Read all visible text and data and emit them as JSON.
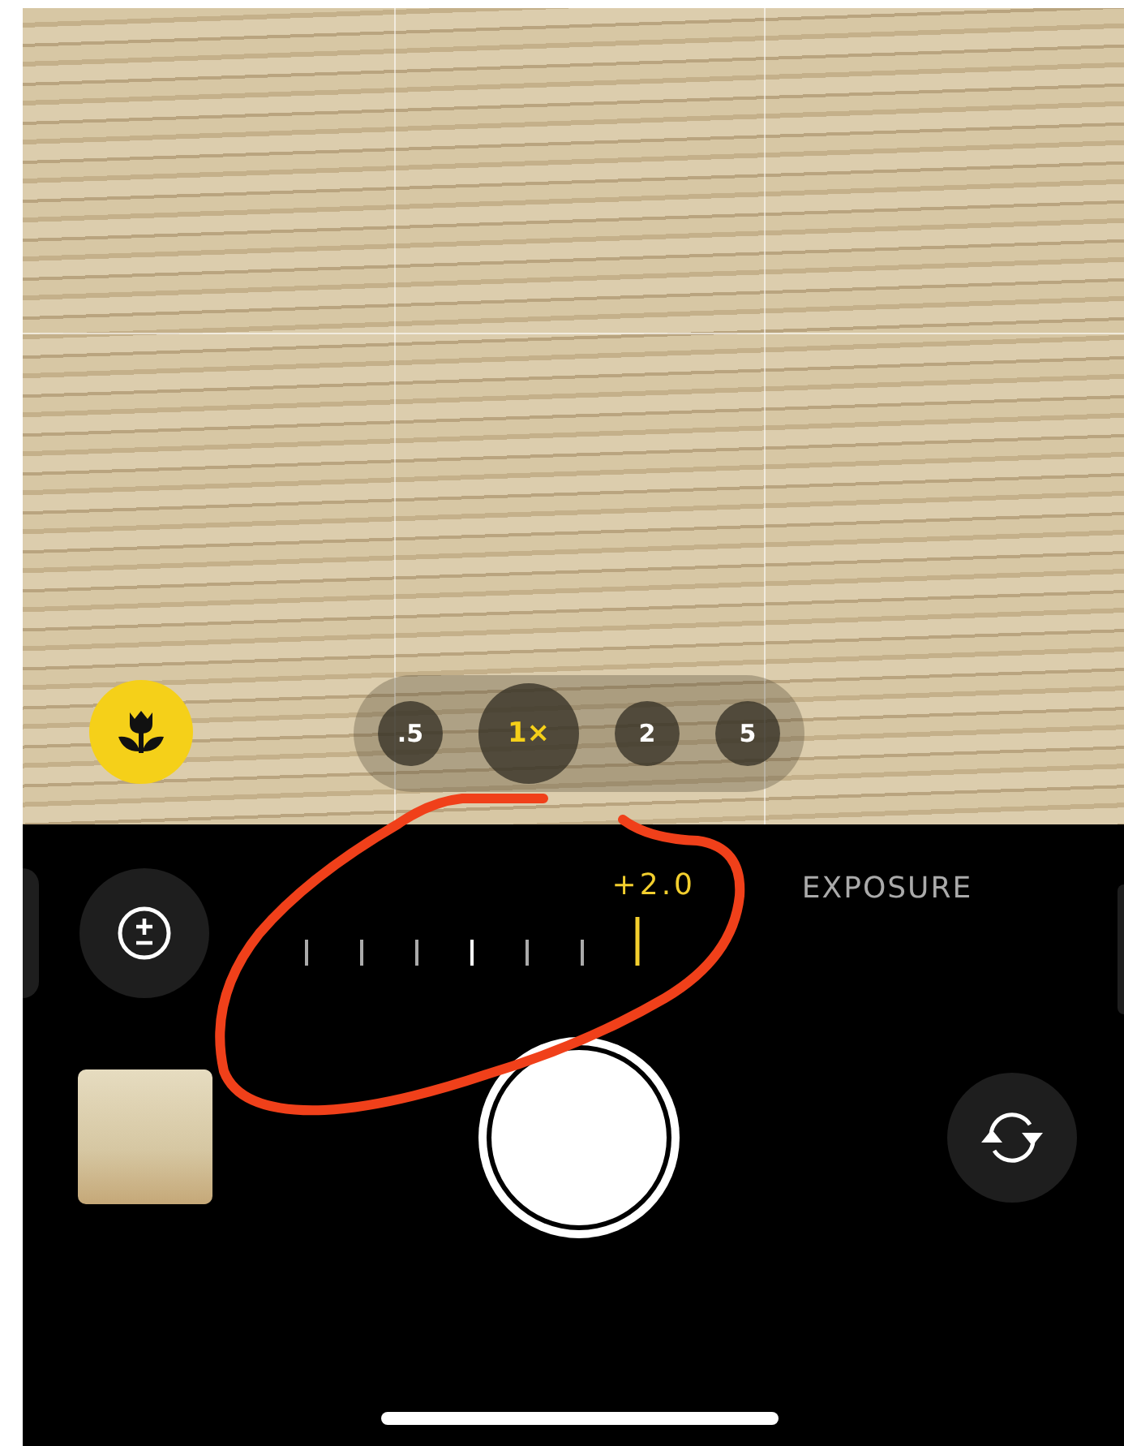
{
  "viewfinder": {
    "macro": {
      "on": true
    },
    "zoom_levels": [
      {
        "label": ".5",
        "selected": false
      },
      {
        "label": "1×",
        "selected": true
      },
      {
        "label": "2",
        "selected": false
      },
      {
        "label": "5",
        "selected": false
      }
    ]
  },
  "exposure": {
    "reading": "+2.0",
    "label": "EXPOSURE"
  }
}
